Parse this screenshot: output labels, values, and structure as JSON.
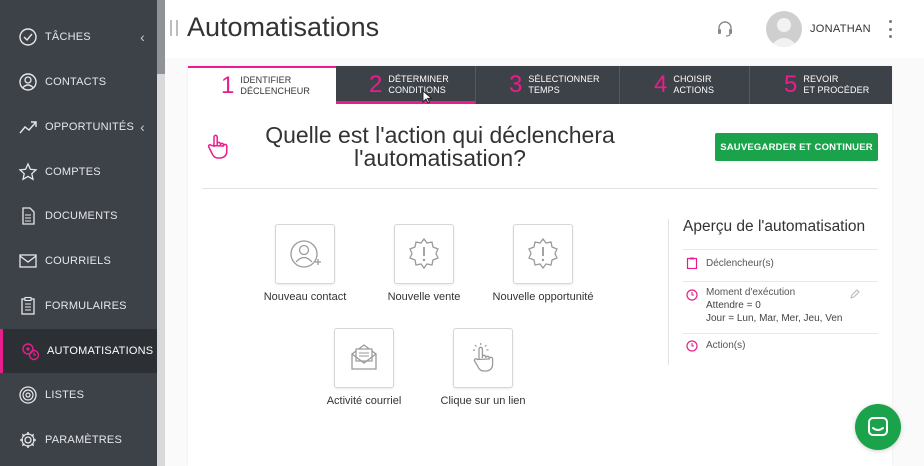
{
  "sidebar": {
    "items": [
      {
        "label": "TÂCHES",
        "icon": "check-circle-icon",
        "chevron": "‹"
      },
      {
        "label": "CONTACTS",
        "icon": "contact-icon",
        "chevron": ""
      },
      {
        "label": "OPPORTUNITÉS",
        "icon": "opportunities-icon",
        "chevron": "‹"
      },
      {
        "label": "COMPTES",
        "icon": "star-icon",
        "chevron": ""
      },
      {
        "label": "DOCUMENTS",
        "icon": "document-icon",
        "chevron": ""
      },
      {
        "label": "COURRIELS",
        "icon": "mail-icon",
        "chevron": ""
      },
      {
        "label": "FORMULAIRES",
        "icon": "clipboard-icon",
        "chevron": ""
      },
      {
        "label": "AUTOMATISATIONS",
        "icon": "automation-icon",
        "chevron": ""
      },
      {
        "label": "LISTES",
        "icon": "list-icon",
        "chevron": ""
      },
      {
        "label": "PARAMÈTRES",
        "icon": "gear-icon",
        "chevron": ""
      }
    ],
    "active_index": 7
  },
  "header": {
    "title": "Automatisations",
    "user_name": "JONATHAN"
  },
  "steps": [
    {
      "num": "1",
      "line1": "IDENTIFIER",
      "line2": "DÉCLENCHEUR"
    },
    {
      "num": "2",
      "line1": "DÉTERMINER",
      "line2": "CONDITIONS"
    },
    {
      "num": "3",
      "line1": "SÉLECTIONNER",
      "line2": "TEMPS"
    },
    {
      "num": "4",
      "line1": "CHOISIR",
      "line2": "ACTIONS"
    },
    {
      "num": "5",
      "line1": "REVOIR",
      "line2": "ET PROCÉDER"
    }
  ],
  "question": "Quelle est l'action qui déclenchera l'automatisation?",
  "save_button": "SAUVEGARDER ET CONTINUER",
  "triggers": [
    {
      "label": "Nouveau contact",
      "icon": "new-contact-icon"
    },
    {
      "label": "Nouvelle vente",
      "icon": "new-sale-icon"
    },
    {
      "label": "Nouvelle opportunité",
      "icon": "new-opportunity-icon"
    },
    {
      "label": "Activité courriel",
      "icon": "email-activity-icon"
    },
    {
      "label": "Clique sur un lien",
      "icon": "link-click-icon"
    }
  ],
  "preview": {
    "title": "Aperçu de l'automatisation",
    "triggers_label": "Déclencheur(s)",
    "moment_label": "Moment d'exécution",
    "moment_wait": "Attendre = 0",
    "moment_days": "Jour = Lun, Mar, Mer, Jeu, Ven",
    "actions_label": "Action(s)"
  },
  "colors": {
    "accent": "#e91e8c",
    "primary_button": "#1aa34a",
    "sidebar_bg": "#3d4148"
  }
}
